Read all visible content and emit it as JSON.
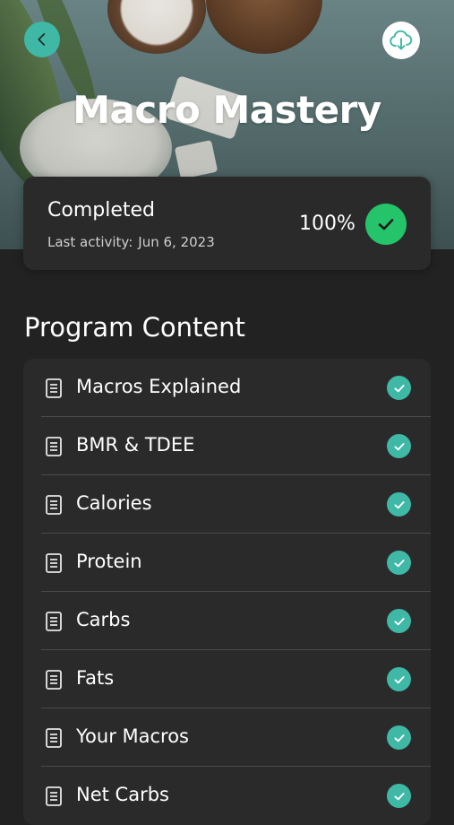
{
  "header": {
    "title": "Macro Mastery",
    "back_icon": "chevron-left-icon",
    "download_icon": "cloud-download-icon"
  },
  "status": {
    "label": "Completed",
    "last_activity_label": "Last activity:",
    "last_activity_date": "Jun 6, 2023",
    "percent": "100%",
    "check_color": "#25c46a"
  },
  "program": {
    "title": "Program Content",
    "items": [
      {
        "label": "Macros Explained",
        "completed": true
      },
      {
        "label": "BMR & TDEE",
        "completed": true
      },
      {
        "label": "Calories",
        "completed": true
      },
      {
        "label": "Protein",
        "completed": true
      },
      {
        "label": "Carbs",
        "completed": true
      },
      {
        "label": "Fats",
        "completed": true
      },
      {
        "label": "Your Macros",
        "completed": true
      },
      {
        "label": "Net Carbs",
        "completed": true
      }
    ]
  },
  "colors": {
    "accent": "#3fb8a6",
    "background": "#222222",
    "card": "#2a2a2a"
  }
}
